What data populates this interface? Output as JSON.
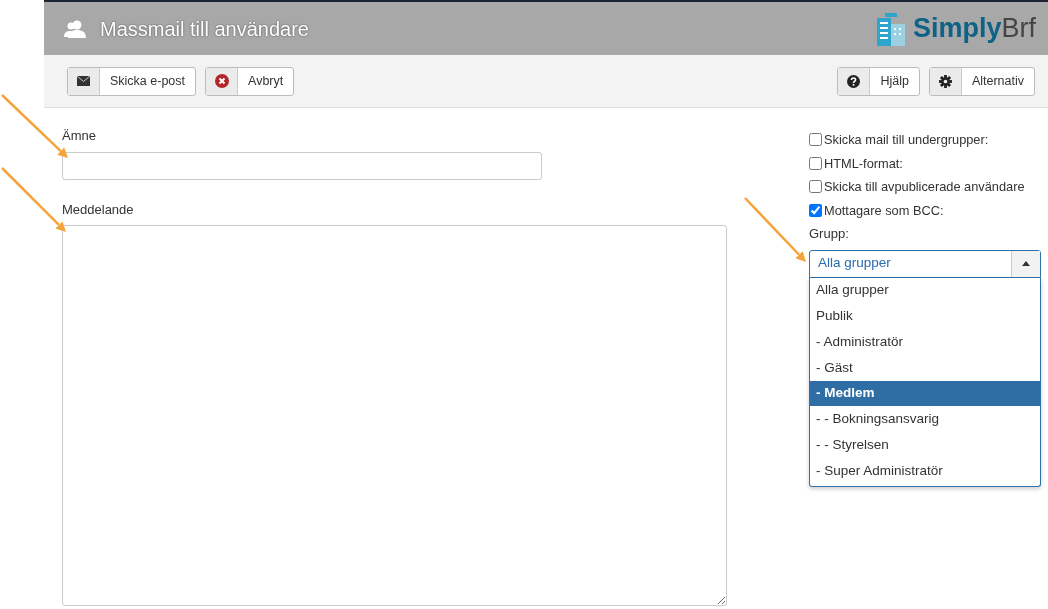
{
  "header": {
    "title": "Massmail till användare",
    "logo": {
      "brand": "Simply",
      "suffix": "Brf"
    }
  },
  "toolbar": {
    "left": [
      {
        "kind": "mail",
        "label": "Skicka e-post"
      },
      {
        "kind": "cancel",
        "label": "Avbryt"
      }
    ],
    "right": [
      {
        "kind": "help",
        "label": "Hjälp"
      },
      {
        "kind": "options",
        "label": "Alternativ"
      }
    ]
  },
  "form": {
    "subject": {
      "label": "Ämne"
    },
    "message": {
      "label": "Meddelande"
    }
  },
  "options": [
    {
      "label": "Skicka mail till undergrupper:",
      "checked": false
    },
    {
      "label": "HTML-format:",
      "checked": false
    },
    {
      "label": "Skicka till avpublicerade användare",
      "checked": false
    },
    {
      "label": "Mottagare som BCC:",
      "checked": true
    }
  ],
  "group": {
    "label": "Grupp:",
    "value": "Alla grupper",
    "expanded": true,
    "items": [
      {
        "label": "Alla grupper",
        "highlighted": false
      },
      {
        "label": "Publik",
        "highlighted": false
      },
      {
        "label": "- Administratör",
        "highlighted": false
      },
      {
        "label": "- Gäst",
        "highlighted": false
      },
      {
        "label": "- Medlem",
        "highlighted": true
      },
      {
        "label": "- - Bokningsansvarig",
        "highlighted": false
      },
      {
        "label": "- - Styrelsen",
        "highlighted": false
      },
      {
        "label": "- Super Administratör",
        "highlighted": false
      }
    ]
  },
  "annotations": [
    {
      "kind": "arrow"
    },
    {
      "kind": "arrow"
    },
    {
      "kind": "arrow"
    }
  ]
}
